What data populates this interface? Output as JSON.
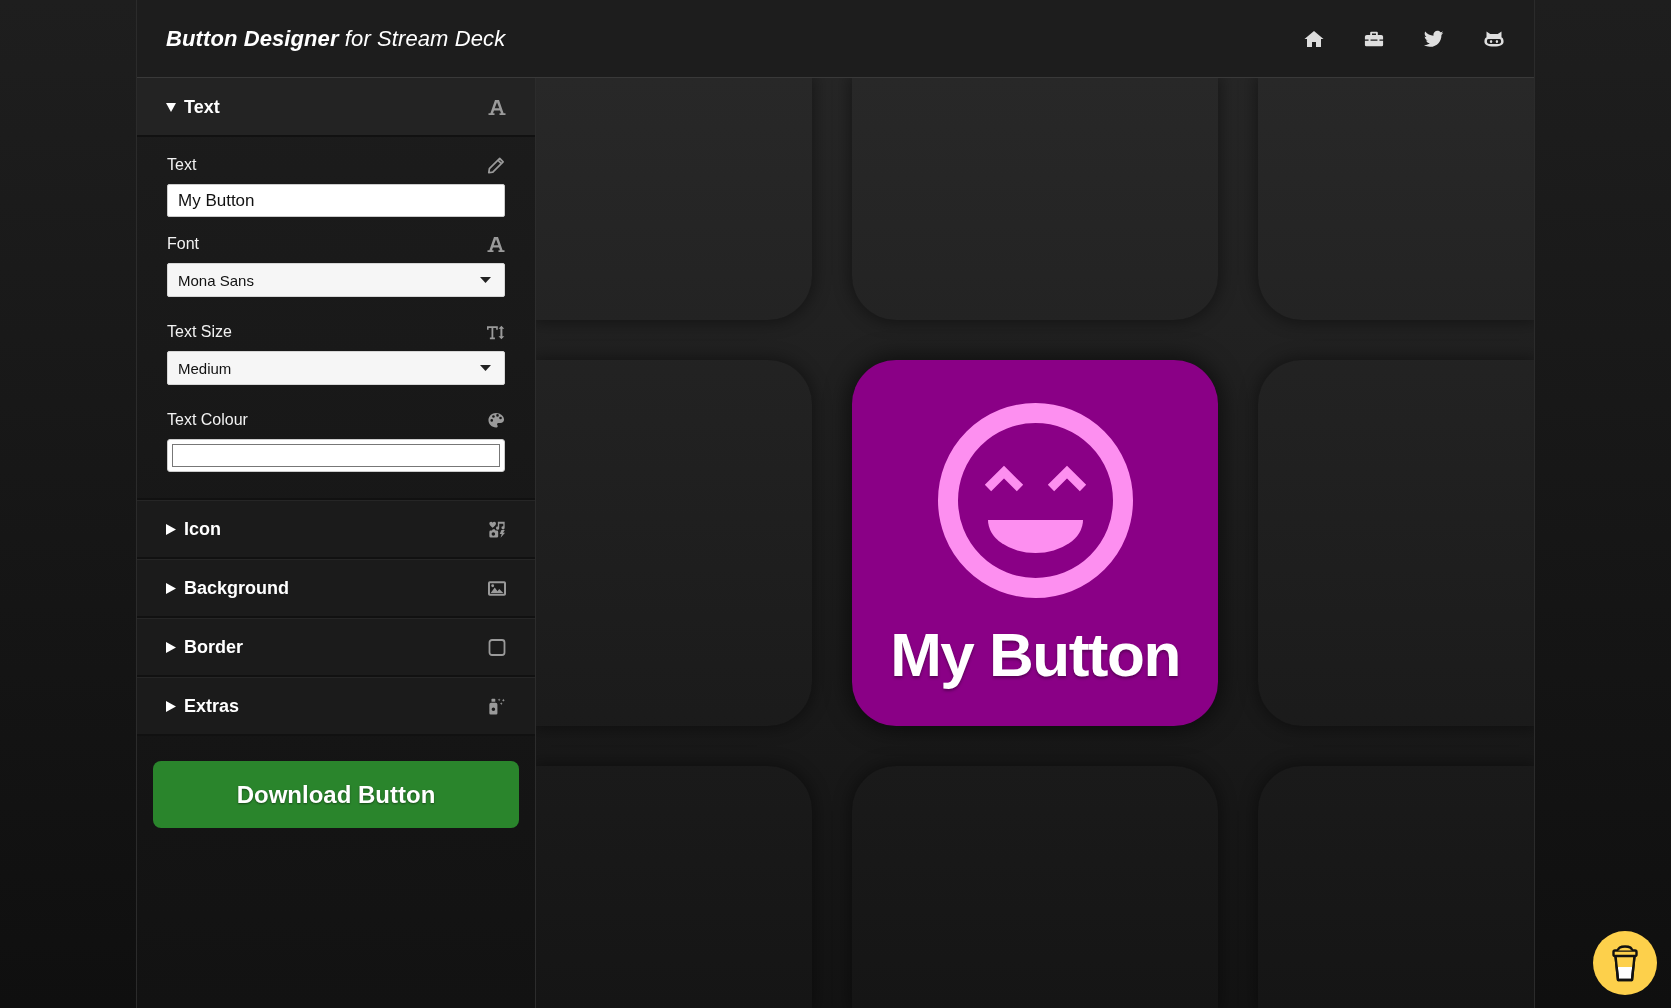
{
  "header": {
    "title": "**Button Designer** for Stream Deck"
  },
  "sections": [
    {
      "title": "Text",
      "expanded": true,
      "fields": [
        {
          "kind": "text",
          "label": "Text",
          "value": "My Button"
        },
        {
          "kind": "select",
          "label": "Font",
          "value": "Mona Sans"
        },
        {
          "kind": "select",
          "label": "Text Size",
          "value": "Medium"
        },
        {
          "kind": "color",
          "label": "Text Colour",
          "color": "#ffffff"
        }
      ]
    },
    {
      "title": "Icon",
      "expanded": false
    },
    {
      "title": "Background",
      "expanded": false
    },
    {
      "title": "Border",
      "expanded": false
    },
    {
      "title": "Extras",
      "expanded": false
    }
  ],
  "download_button": {
    "label": "Download Button"
  },
  "preview": {
    "text": "My Button"
  }
}
